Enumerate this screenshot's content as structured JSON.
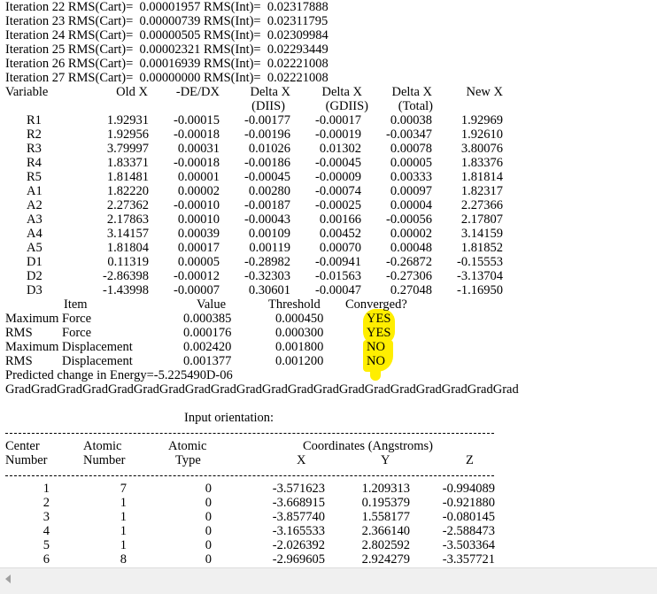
{
  "iterations": [
    {
      "text": "Iteration 22 RMS(Cart)=  0.00001957 RMS(Int)=  0.02317888"
    },
    {
      "text": "Iteration 23 RMS(Cart)=  0.00000739 RMS(Int)=  0.02311795"
    },
    {
      "text": "Iteration 24 RMS(Cart)=  0.00000505 RMS(Int)=  0.02309984"
    },
    {
      "text": "Iteration 25 RMS(Cart)=  0.00002321 RMS(Int)=  0.02293449"
    },
    {
      "text": "Iteration 26 RMS(Cart)=  0.00016939 RMS(Int)=  0.02221008"
    },
    {
      "text": "Iteration 27 RMS(Cart)=  0.00000000 RMS(Int)=  0.02221008"
    }
  ],
  "var_headers": {
    "variable": "Variable",
    "old_x": "Old X",
    "de_dx": "-DE/DX",
    "delta_diis": "Delta X",
    "delta_gdiis": "Delta X",
    "delta_total": "Delta X",
    "new_x": "New X",
    "sub_diis": "(DIIS)",
    "sub_gdiis": "(GDIIS)",
    "sub_total": "(Total)"
  },
  "variables": [
    {
      "name": "R1",
      "old": "1.92931",
      "dedx": "-0.00015",
      "diis": "-0.00177",
      "gdiis": "-0.00017",
      "total": "0.00038",
      "new": "1.92969"
    },
    {
      "name": "R2",
      "old": "1.92956",
      "dedx": "-0.00018",
      "diis": "-0.00196",
      "gdiis": "-0.00019",
      "total": "-0.00347",
      "new": "1.92610"
    },
    {
      "name": "R3",
      "old": "3.79997",
      "dedx": "0.00031",
      "diis": "0.01026",
      "gdiis": "0.01302",
      "total": "0.00078",
      "new": "3.80076"
    },
    {
      "name": "R4",
      "old": "1.83371",
      "dedx": "-0.00018",
      "diis": "-0.00186",
      "gdiis": "-0.00045",
      "total": "0.00005",
      "new": "1.83376"
    },
    {
      "name": "R5",
      "old": "1.81481",
      "dedx": "0.00001",
      "diis": "-0.00045",
      "gdiis": "-0.00009",
      "total": "0.00333",
      "new": "1.81814"
    },
    {
      "name": "A1",
      "old": "1.82220",
      "dedx": "0.00002",
      "diis": "0.00280",
      "gdiis": "-0.00074",
      "total": "0.00097",
      "new": "1.82317"
    },
    {
      "name": "A2",
      "old": "2.27362",
      "dedx": "-0.00010",
      "diis": "-0.00187",
      "gdiis": "-0.00025",
      "total": "0.00004",
      "new": "2.27366"
    },
    {
      "name": "A3",
      "old": "2.17863",
      "dedx": "0.00010",
      "diis": "-0.00043",
      "gdiis": "0.00166",
      "total": "-0.00056",
      "new": "2.17807"
    },
    {
      "name": "A4",
      "old": "3.14157",
      "dedx": "0.00039",
      "diis": "0.00109",
      "gdiis": "0.00452",
      "total": "0.00002",
      "new": "3.14159"
    },
    {
      "name": "A5",
      "old": "1.81804",
      "dedx": "0.00017",
      "diis": "0.00119",
      "gdiis": "0.00070",
      "total": "0.00048",
      "new": "1.81852"
    },
    {
      "name": "D1",
      "old": "0.11319",
      "dedx": "0.00005",
      "diis": "-0.28982",
      "gdiis": "-0.00941",
      "total": "-0.26872",
      "new": "-0.15553"
    },
    {
      "name": "D2",
      "old": "-2.86398",
      "dedx": "-0.00012",
      "diis": "-0.32303",
      "gdiis": "-0.01563",
      "total": "-0.27306",
      "new": "-3.13704"
    },
    {
      "name": "D3",
      "old": "-1.43998",
      "dedx": "-0.00007",
      "diis": "0.30601",
      "gdiis": "-0.00047",
      "total": "0.27048",
      "new": "-1.16950"
    }
  ],
  "conv_headers": {
    "item": "Item",
    "value": "Value",
    "threshold": "Threshold",
    "converged": "Converged?"
  },
  "convergence": [
    {
      "prefix": "Maximum",
      "label": "Force",
      "value": "0.000385",
      "threshold": "0.000450",
      "status": "YES"
    },
    {
      "prefix": "RMS",
      "label": "Force",
      "value": "0.000176",
      "threshold": "0.000300",
      "status": "YES"
    },
    {
      "prefix": "Maximum",
      "label": "Displacement",
      "value": "0.002420",
      "threshold": "0.001800",
      "status": "NO"
    },
    {
      "prefix": "RMS",
      "label": "Displacement",
      "value": "0.001377",
      "threshold": "0.001200",
      "status": "NO"
    }
  ],
  "predicted_change": "Predicted change in Energy=-5.225490D-06",
  "grad_line": "GradGradGradGradGradGradGradGradGradGradGradGradGradGradGradGradGradGradGradGrad",
  "orientation_title": "Input orientation:",
  "orient_headers": {
    "center": "Center",
    "center2": "Number",
    "atomic_num": "Atomic",
    "atomic_num2": "Number",
    "atomic_type": "Atomic",
    "atomic_type2": "Type",
    "coords": "Coordinates (Angstroms)",
    "x": "X",
    "y": "Y",
    "z": "Z"
  },
  "atoms": [
    {
      "center": "1",
      "number": "7",
      "type": "0",
      "x": "-3.571623",
      "y": "1.209313",
      "z": "-0.994089"
    },
    {
      "center": "2",
      "number": "1",
      "type": "0",
      "x": "-3.668915",
      "y": "0.195379",
      "z": "-0.921880"
    },
    {
      "center": "3",
      "number": "1",
      "type": "0",
      "x": "-3.857740",
      "y": "1.558177",
      "z": "-0.080145"
    },
    {
      "center": "4",
      "number": "1",
      "type": "0",
      "x": "-3.165533",
      "y": "2.366140",
      "z": "-2.588473"
    },
    {
      "center": "5",
      "number": "1",
      "type": "0",
      "x": "-2.026392",
      "y": "2.802592",
      "z": "-3.503364"
    },
    {
      "center": "6",
      "number": "8",
      "type": "0",
      "x": "-2.969605",
      "y": "2.924279",
      "z": "-3.357721"
    }
  ],
  "colors": {
    "highlight": "#ffee00",
    "background": "#ffffff",
    "scrollbar": "#f0f0f0"
  },
  "icons": {
    "scroll_left": "scroll-left-arrow-icon"
  }
}
